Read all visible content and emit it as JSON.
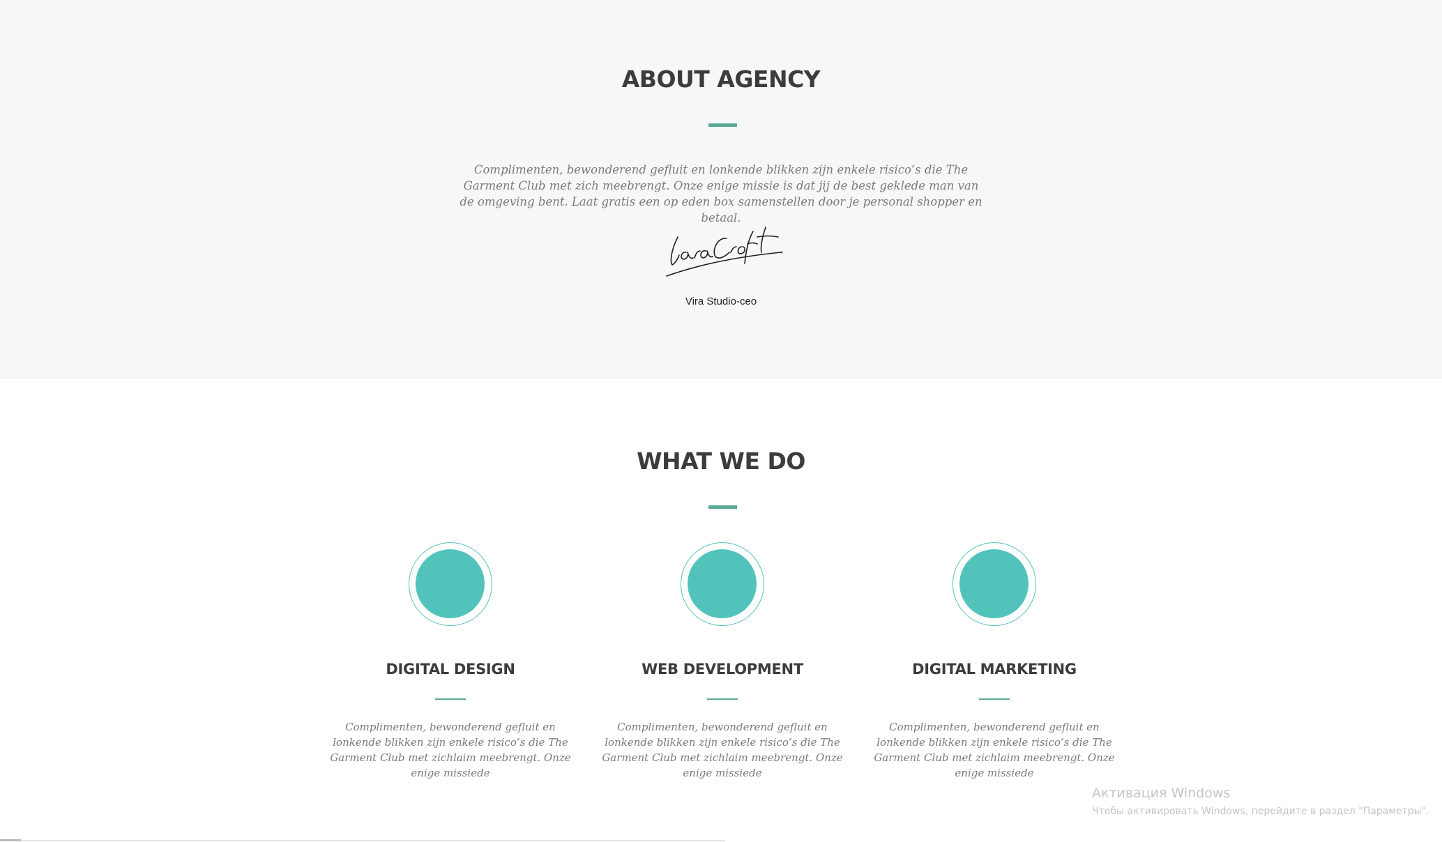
{
  "about": {
    "title": "ABOUT AGENCY",
    "text": "Complimenten, bewonderend gefluit en lonkende blikken zijn enkele risico’s die The Garment Club met zich meebrengt. Onze enige missie is dat jij de best geklede man van de omgeving bent. Laat gratis een op eden box samenstellen door je personal shopper en betaal.",
    "signature": "LaraCroft",
    "ceo": "Vira Studio-ceo"
  },
  "services": {
    "title": "WHAT WE DO",
    "items": [
      {
        "title": "DIGITAL DESIGN",
        "text": "Complimenten, bewonderend gefluit en lonkende blikken zijn enkele risico’s die The Garment Club met zichlaim meebrengt. Onze enige missiede"
      },
      {
        "title": "WEB DEVELOPMENT",
        "text": "Complimenten, bewonderend gefluit en lonkende blikken zijn enkele risico’s die The Garment Club met zichlaim meebrengt. Onze enige missiede"
      },
      {
        "title": "DIGITAL MARKETING",
        "text": "Complimenten, bewonderend gefluit en lonkende blikken zijn enkele risico’s die The Garment Club met zichlaim meebrengt. Onze enige missiede"
      }
    ]
  },
  "watermark": {
    "title": "Активация Windows",
    "subtitle": "Чтобы активировать Windows, перейдите в раздел \"Параметры\"."
  },
  "colors": {
    "accent": "#59ab96",
    "circle": "#52c3bb",
    "about_bg": "#f7f7f7",
    "heading": "#3c3c3c",
    "body_text": "#7a7a7a"
  }
}
